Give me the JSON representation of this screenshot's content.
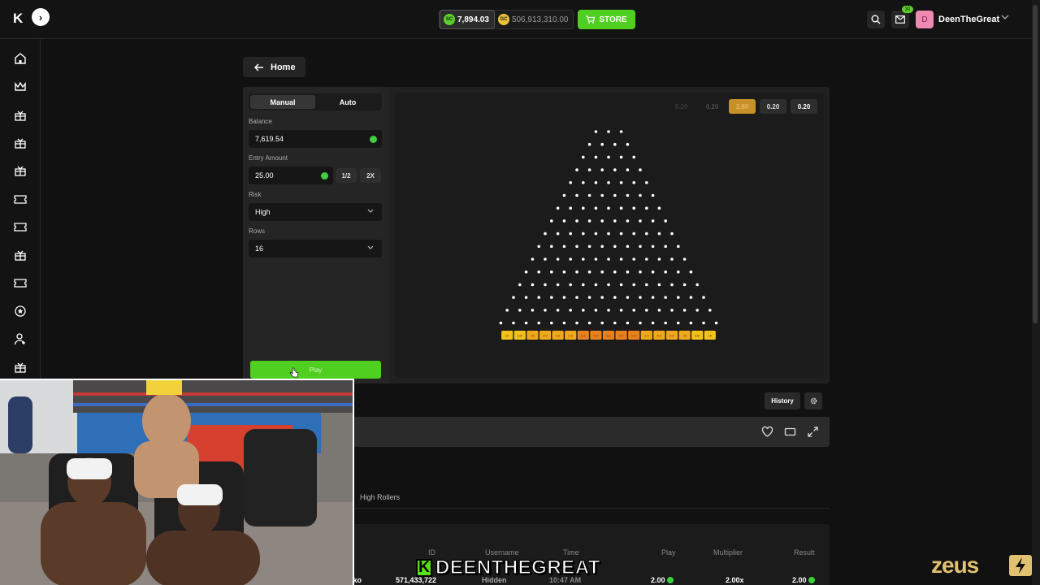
{
  "header": {
    "logo": "K",
    "balances": {
      "sc_label": "SC",
      "sc_value": "7,894.03",
      "gc_label": "GC",
      "gc_value": "506,913,310.00"
    },
    "store_label": "STORE",
    "mail_badge": "30",
    "avatar_initial": "D",
    "username": "DeenTheGreat"
  },
  "nav": {
    "back_label": "Home"
  },
  "game": {
    "mode_tabs": [
      "Manual",
      "Auto"
    ],
    "balance_label": "Balance",
    "balance_value": "7,619.54",
    "entry_label": "Entry Amount",
    "entry_value": "25.00",
    "half_label": "1/2",
    "double_label": "2X",
    "risk_label": "Risk",
    "risk_value": "High",
    "rows_label": "Rows",
    "rows_value": "16",
    "play_label": "Play",
    "recent_multipliers": [
      "0.20",
      "0.20",
      "3.80",
      "0.20",
      "0.20"
    ],
    "buckets": [
      "1K",
      "130",
      "26",
      "9.0",
      "4.0",
      "2.0",
      "0.2",
      "0.2",
      "0.2",
      "0.2",
      "0.2",
      "2.0",
      "4.0",
      "9.0",
      "26",
      "130",
      "1K"
    ],
    "peg_rows": 16
  },
  "history_label": "History",
  "leaderboard": {
    "tab": "High Rollers",
    "columns": [
      "ID",
      "Username",
      "Time",
      "Play",
      "Multiplier",
      "Result"
    ],
    "row": {
      "game": "Plinko",
      "id": "571,433,722",
      "username": "Hidden",
      "time": "10:47 AM",
      "play": "2.00",
      "multiplier": "2.00x",
      "result": "2.00"
    }
  },
  "stream": {
    "caption_badge": "K",
    "caption": "DEENTHEGREAT",
    "watermark": "zeus"
  },
  "colors": {
    "accent_green": "#4fcf1f",
    "bucket_yellow": "#f2c21b",
    "bucket_orange": "#e8801d",
    "highlight_gold": "#c8902a"
  }
}
